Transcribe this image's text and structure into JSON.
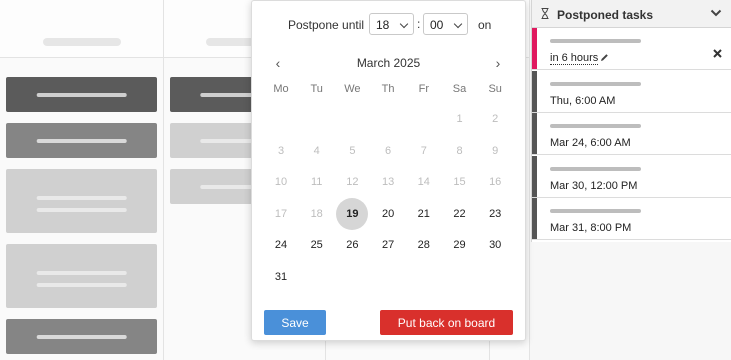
{
  "popup": {
    "postpone_label": "Postpone until",
    "hour": "18",
    "minute": "00",
    "colon": ":",
    "on_label": "on",
    "month_title": "March 2025",
    "prev_icon": "chevron-left-icon",
    "next_icon": "chevron-right-icon",
    "weekdays": [
      "Mo",
      "Tu",
      "We",
      "Th",
      "Fr",
      "Sa",
      "Su"
    ],
    "days": [
      {
        "d": "1",
        "state": "disabled"
      },
      {
        "d": "2",
        "state": "disabled"
      },
      {
        "d": "3",
        "state": "disabled"
      },
      {
        "d": "4",
        "state": "disabled"
      },
      {
        "d": "5",
        "state": "disabled"
      },
      {
        "d": "6",
        "state": "disabled"
      },
      {
        "d": "7",
        "state": "disabled"
      },
      {
        "d": "8",
        "state": "disabled"
      },
      {
        "d": "9",
        "state": "disabled"
      },
      {
        "d": "10",
        "state": "disabled"
      },
      {
        "d": "11",
        "state": "disabled"
      },
      {
        "d": "12",
        "state": "disabled"
      },
      {
        "d": "13",
        "state": "disabled"
      },
      {
        "d": "14",
        "state": "disabled"
      },
      {
        "d": "15",
        "state": "disabled"
      },
      {
        "d": "16",
        "state": "disabled"
      },
      {
        "d": "17",
        "state": "disabled"
      },
      {
        "d": "18",
        "state": "disabled"
      },
      {
        "d": "19",
        "state": "today"
      },
      {
        "d": "20",
        "state": "enabled"
      },
      {
        "d": "21",
        "state": "enabled"
      },
      {
        "d": "22",
        "state": "enabled"
      },
      {
        "d": "23",
        "state": "enabled"
      },
      {
        "d": "24",
        "state": "enabled"
      },
      {
        "d": "25",
        "state": "enabled"
      },
      {
        "d": "26",
        "state": "enabled"
      },
      {
        "d": "27",
        "state": "enabled"
      },
      {
        "d": "28",
        "state": "enabled"
      },
      {
        "d": "29",
        "state": "enabled"
      },
      {
        "d": "30",
        "state": "enabled"
      },
      {
        "d": "31",
        "state": "enabled"
      }
    ],
    "first_weekday_index": 5,
    "save_label": "Save",
    "put_back_label": "Put back on board",
    "colors": {
      "save": "#4a90d9",
      "put_back": "#d9302c"
    }
  },
  "panel": {
    "title": "Postponed tasks",
    "title_icon": "hourglass-icon",
    "collapse_icon": "chevron-down-icon",
    "items": [
      {
        "when": "in 6 hours",
        "active": true,
        "edit_icon": "pencil-icon",
        "remove_icon": "close-icon"
      },
      {
        "when": "Thu, 6:00 AM",
        "active": false
      },
      {
        "when": "Mar 24, 6:00 AM",
        "active": false
      },
      {
        "when": "Mar 30, 12:00 PM",
        "active": false
      },
      {
        "when": "Mar 31, 8:00 PM",
        "active": false
      }
    ],
    "colors": {
      "active_stripe": "#e0195f",
      "stripe": "#555555"
    }
  }
}
